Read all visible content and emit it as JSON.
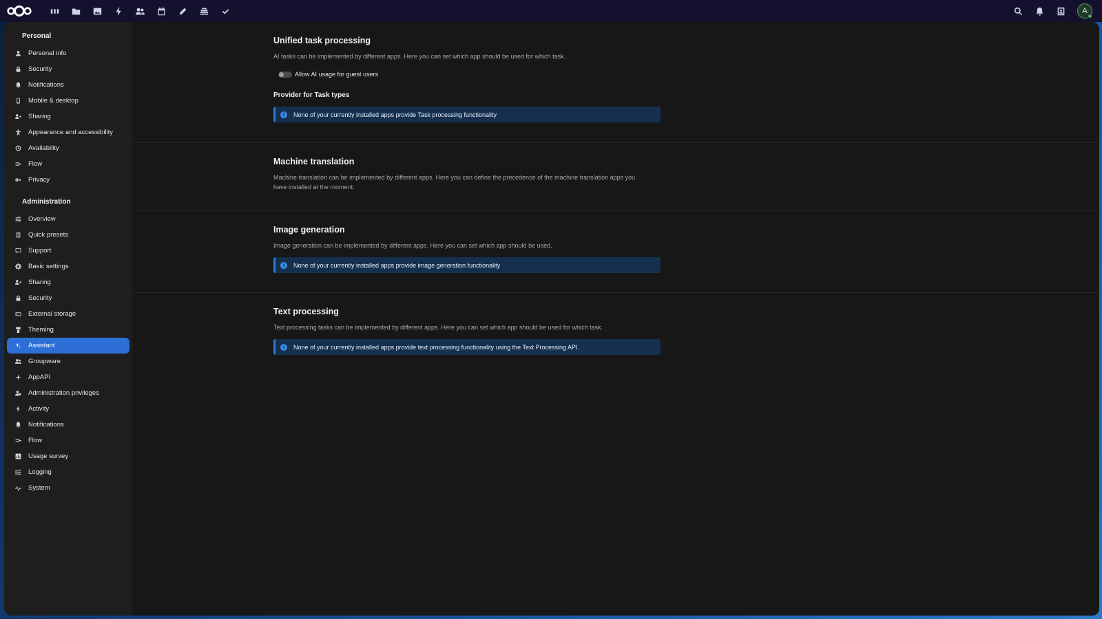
{
  "topbar": {
    "apps": [
      {
        "name": "dashboard-icon"
      },
      {
        "name": "files-icon"
      },
      {
        "name": "photos-icon"
      },
      {
        "name": "activity-icon"
      },
      {
        "name": "contacts-icon"
      },
      {
        "name": "calendar-icon"
      },
      {
        "name": "notes-icon"
      },
      {
        "name": "deck-icon"
      },
      {
        "name": "tasks-icon"
      }
    ],
    "right": [
      {
        "name": "search-icon"
      },
      {
        "name": "notifications-icon"
      },
      {
        "name": "contacts-menu-icon"
      }
    ],
    "avatar_initial": "A"
  },
  "sidebar": {
    "personal_caption": "Personal",
    "personal_items": [
      {
        "label": "Personal info",
        "icon": "user-icon"
      },
      {
        "label": "Security",
        "icon": "lock-icon"
      },
      {
        "label": "Notifications",
        "icon": "bell-icon"
      },
      {
        "label": "Mobile & desktop",
        "icon": "phone-icon"
      },
      {
        "label": "Sharing",
        "icon": "share-icon"
      },
      {
        "label": "Appearance and accessibility",
        "icon": "accessibility-icon"
      },
      {
        "label": "Availability",
        "icon": "clock-icon"
      },
      {
        "label": "Flow",
        "icon": "flow-icon"
      },
      {
        "label": "Privacy",
        "icon": "key-icon"
      }
    ],
    "admin_caption": "Administration",
    "admin_items": [
      {
        "label": "Overview",
        "icon": "sliders-icon"
      },
      {
        "label": "Quick presets",
        "icon": "presets-icon"
      },
      {
        "label": "Support",
        "icon": "support-icon"
      },
      {
        "label": "Basic settings",
        "icon": "gear-icon"
      },
      {
        "label": "Sharing",
        "icon": "share-icon"
      },
      {
        "label": "Security",
        "icon": "lock-icon"
      },
      {
        "label": "External storage",
        "icon": "storage-icon"
      },
      {
        "label": "Theming",
        "icon": "paint-icon"
      },
      {
        "label": "Assistant",
        "icon": "sparkle-icon",
        "active": true
      },
      {
        "label": "Groupware",
        "icon": "group-icon"
      },
      {
        "label": "AppAPI",
        "icon": "appapi-icon"
      },
      {
        "label": "Administration privileges",
        "icon": "admin-users-icon"
      },
      {
        "label": "Activity",
        "icon": "lightning-icon"
      },
      {
        "label": "Notifications",
        "icon": "bell-icon"
      },
      {
        "label": "Flow",
        "icon": "flow-icon"
      },
      {
        "label": "Usage survey",
        "icon": "chart-icon"
      },
      {
        "label": "Logging",
        "icon": "list-icon"
      },
      {
        "label": "System",
        "icon": "pulse-icon"
      }
    ]
  },
  "sections": {
    "unified": {
      "title": "Unified task processing",
      "desc": "AI tasks can be implemented by different apps. Here you can set which app should be used for which task.",
      "toggle_label": "Allow AI usage for guest users",
      "toggle_on": false,
      "provider_heading": "Provider for Task types",
      "note": "None of your currently installed apps provide Task processing functionality"
    },
    "translation": {
      "title": "Machine translation",
      "desc": "Machine translation can be implemented by different apps. Here you can define the precedence of the machine translation apps you have installed at the moment."
    },
    "image": {
      "title": "Image generation",
      "desc": "Image generation can be implemented by different apps. Here you can set which app should be used.",
      "note": "None of your currently installed apps provide image generation functionality"
    },
    "text": {
      "title": "Text processing",
      "desc": "Text processing tasks can be implemented by different apps. Here you can set which app should be used for which task.",
      "note": "None of your currently installed apps provide text processing functionality using the Text Processing API."
    }
  },
  "colors": {
    "accent": "#2d6fd6",
    "topbar": "#14112e",
    "sidebar": "#1e1e1e",
    "content": "#171717",
    "note_bg": "#15304f"
  }
}
